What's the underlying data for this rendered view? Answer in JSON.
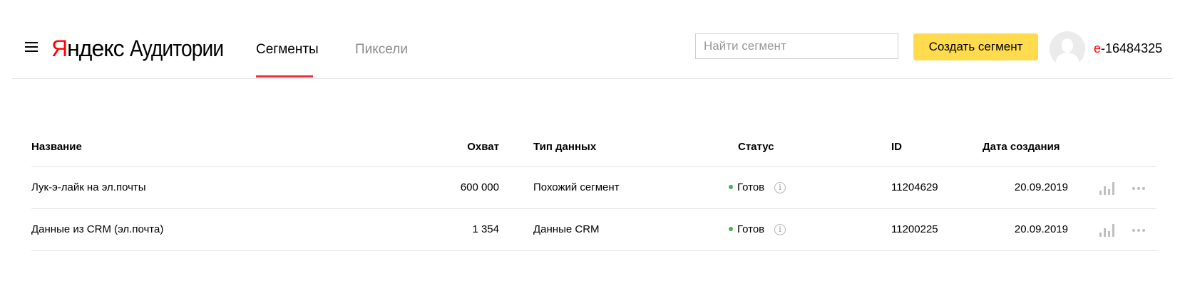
{
  "header": {
    "logo": {
      "brand_first": "Я",
      "brand_rest": "ндекс",
      "product": "Аудитории"
    },
    "tabs": [
      {
        "label": "Сегменты",
        "active": true
      },
      {
        "label": "Пиксели",
        "active": false
      }
    ],
    "search": {
      "placeholder": "Найти сегмент",
      "value": ""
    },
    "create_button": "Создать сегмент",
    "user": {
      "first_letter": "e",
      "rest": "-16484325"
    }
  },
  "table": {
    "columns": {
      "name": "Название",
      "reach": "Охват",
      "data_type": "Тип данных",
      "status": "Статус",
      "id": "ID",
      "created": "Дата создания"
    },
    "rows": [
      {
        "name": "Лук-э-лайк на эл.почты",
        "reach": "600 000",
        "data_type": "Похожий сегмент",
        "status": "Готов",
        "id": "11204629",
        "created": "20.09.2019"
      },
      {
        "name": "Данные из CRM (эл.почта)",
        "reach": "1 354",
        "data_type": "Данные CRM",
        "status": "Готов",
        "id": "11200225",
        "created": "20.09.2019"
      }
    ]
  },
  "colors": {
    "accent_red": "#ff0000",
    "tab_underline": "#e8303a",
    "button_yellow": "#ffdb4d",
    "status_green": "#4caf50"
  },
  "icons": {
    "menu": "hamburger-menu-icon",
    "info": "info-icon",
    "stats": "bar-chart-icon",
    "more": "more-dots-icon"
  }
}
